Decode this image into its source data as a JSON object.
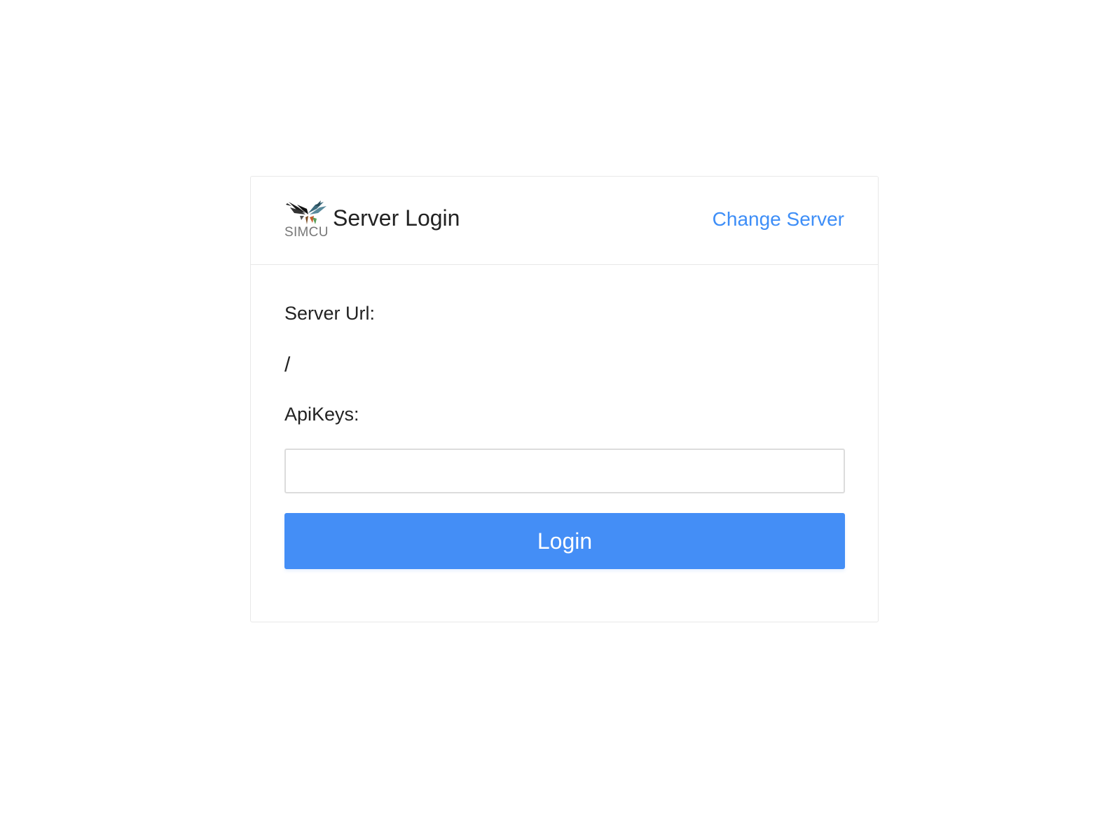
{
  "header": {
    "logo_text": "SIMCU",
    "title": "Server Login",
    "change_server_label": "Change Server"
  },
  "form": {
    "server_url_label": "Server Url:",
    "server_url_value": "/",
    "api_keys_label": "ApiKeys:",
    "api_keys_value": "",
    "api_keys_placeholder": "",
    "login_label": "Login"
  },
  "colors": {
    "accent": "#448ef6",
    "link": "#3e8ef7",
    "border": "#e8e8e8",
    "text": "#222222"
  },
  "icons": {
    "logo": "simcu-bird-logo-icon"
  }
}
